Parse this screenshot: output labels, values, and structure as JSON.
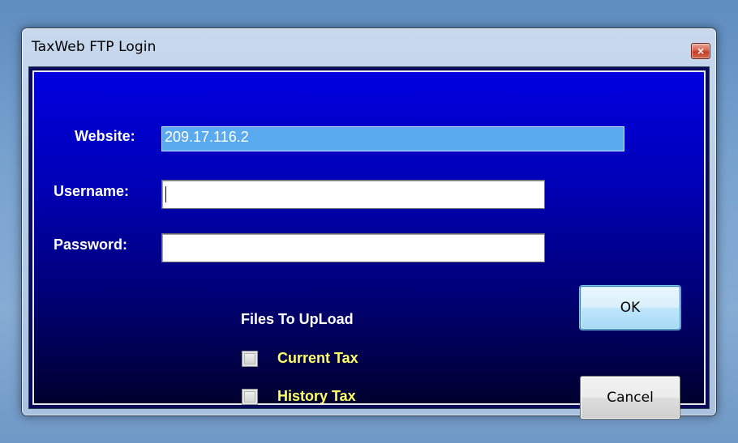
{
  "window": {
    "title": "TaxWeb FTP Login",
    "close_glyph": "×"
  },
  "form": {
    "website_label": "Website:",
    "website_value": "209.17.116.2",
    "username_label": "Username:",
    "username_value": "",
    "password_label": "Password:",
    "password_value": ""
  },
  "files": {
    "group_title": "Files To UpLoad",
    "options": [
      {
        "label": "Current Tax",
        "checked": false
      },
      {
        "label": "History Tax",
        "checked": false
      }
    ]
  },
  "buttons": {
    "ok_label": "OK",
    "cancel_label": "Cancel"
  },
  "colors": {
    "client_gradient_top": "#0000e0",
    "client_gradient_bottom": "#00002e",
    "website_highlight": "#5aaaf0",
    "checkbox_label": "#ffff66"
  },
  "icons": {
    "close": "close-icon"
  }
}
